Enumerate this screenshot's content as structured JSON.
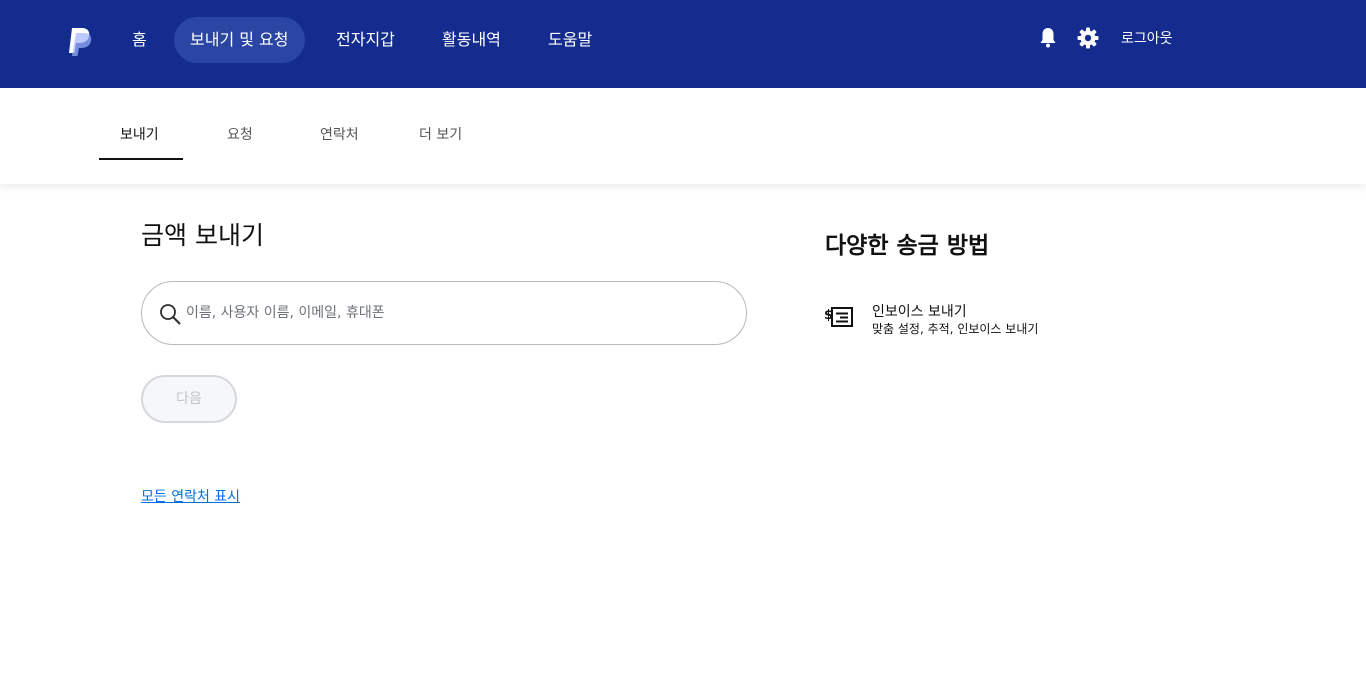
{
  "header": {
    "nav": [
      {
        "label": "홈"
      },
      {
        "label": "보내기 및 요청"
      },
      {
        "label": "전자지갑"
      },
      {
        "label": "활동내역"
      },
      {
        "label": "도움말"
      }
    ],
    "logout_label": "로그아웃",
    "icons": [
      "paypal-logo",
      "bell-icon",
      "gear-icon"
    ]
  },
  "subnav": {
    "tabs": [
      {
        "label": "보내기"
      },
      {
        "label": "요청"
      },
      {
        "label": "연락처"
      },
      {
        "label": "더 보기"
      }
    ],
    "active_tab": "보내기"
  },
  "main": {
    "title": "금액 보내기",
    "search_placeholder": "이름, 사용자 이름, 이메일, 휴대폰",
    "search_value": "",
    "next_label": "다음",
    "all_contacts_link": "모든 연락처 표시"
  },
  "side": {
    "title": "다양한 송금 방법",
    "items": [
      {
        "title": "인보이스 보내기",
        "description": "맞춤 설정, 추적, 인보이스 보내기",
        "icon": "invoice-icon"
      }
    ]
  },
  "colors": {
    "header_bg": "#142c8e",
    "active_nav_bg": "#2a45a3",
    "link": "#0070e0"
  }
}
